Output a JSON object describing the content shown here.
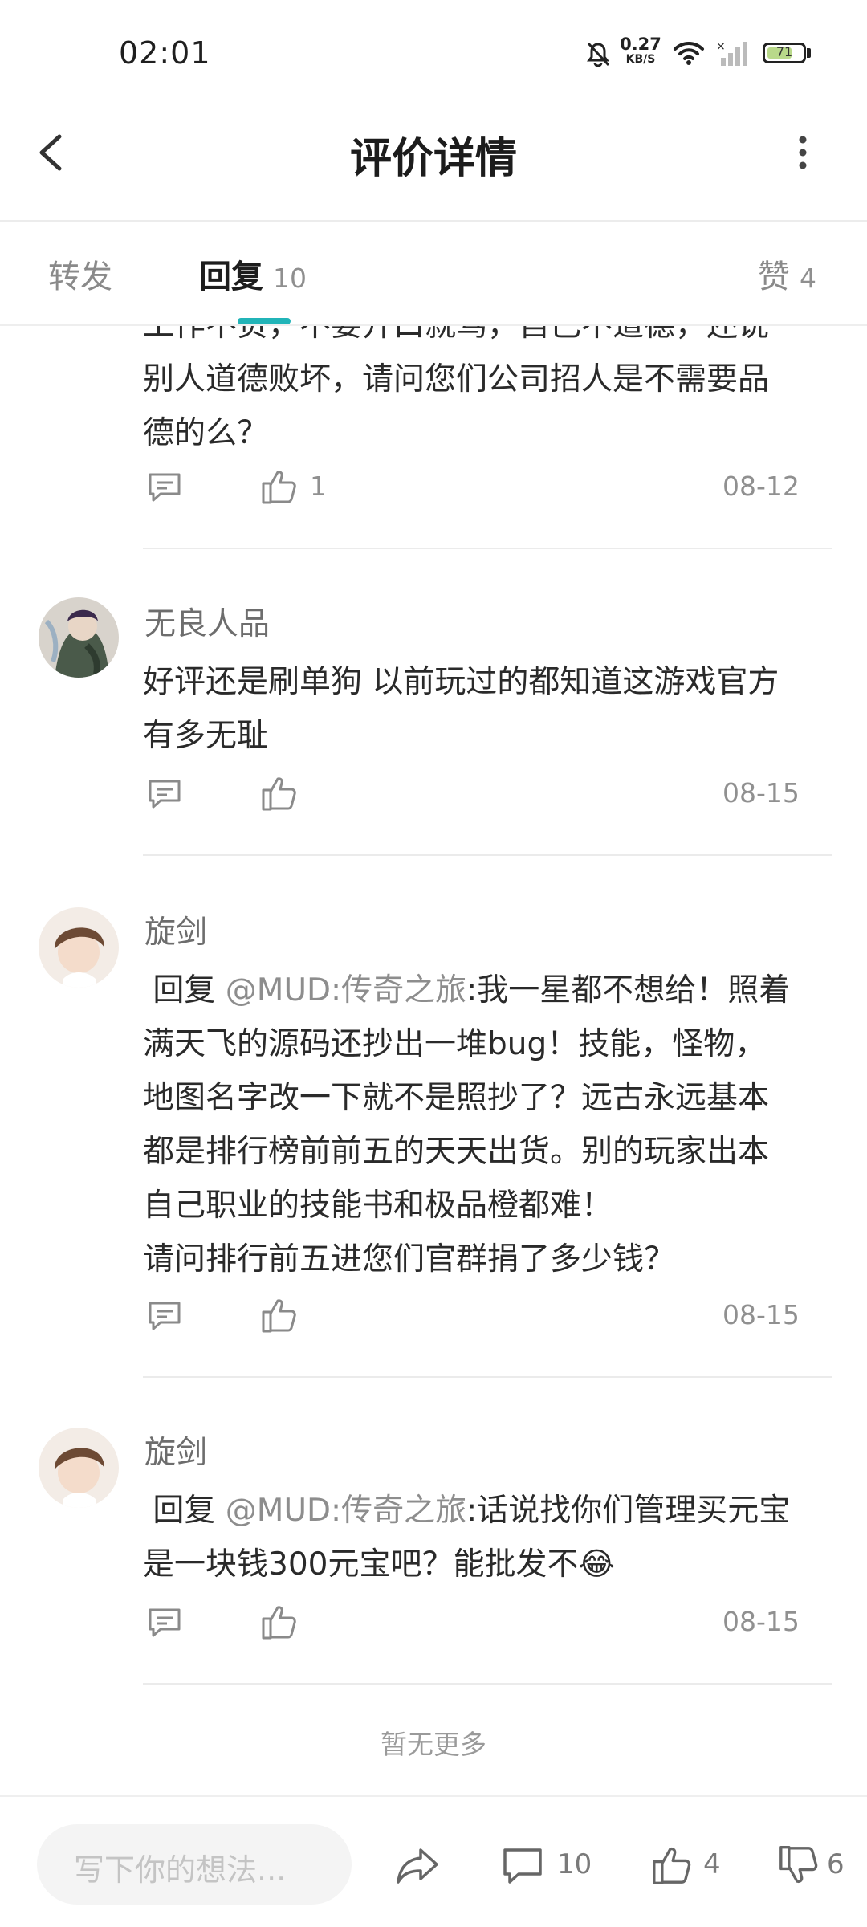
{
  "status_bar": {
    "time": "02:01",
    "net_speed": "0.27",
    "net_unit": "KB/S",
    "battery": "71",
    "battery_level": 0.71
  },
  "header": {
    "title": "评价详情"
  },
  "tabs": {
    "forward": "转发",
    "reply": "回复",
    "reply_count": "10",
    "likes": "赞",
    "likes_count": "4"
  },
  "comments": [
    {
      "lines": [
        "工作不负，不要开口就骂，自己不道德，还说",
        "别人道德败坏，请问您们公司招人是不需要品",
        "德的么？"
      ],
      "likes": "1",
      "date": "08-12"
    },
    {
      "username": "无良人品",
      "lines": [
        "好评还是刷单狗 以前玩过的都知道这游戏官方",
        "有多无耻"
      ],
      "likes": "",
      "date": "08-15"
    },
    {
      "username": "旋剑",
      "reply_prefix": " 回复 ",
      "mention": "@MUD:传奇之旅",
      "first_line_rest": ":我一星都不想给！照着",
      "lines": [
        "满天飞的源码还抄出一堆bug！技能，怪物，",
        "地图名字改一下就不是照抄了？远古永远基本",
        "都是排行榜前前五的天天出货。别的玩家出本",
        "自己职业的技能书和极品橙都难！",
        "请问排行前五进您们官群捐了多少钱？"
      ],
      "likes": "",
      "date": "08-15"
    },
    {
      "username": "旋剑",
      "reply_prefix": " 回复 ",
      "mention": "@MUD:传奇之旅",
      "first_line_rest": ":话说找你们管理买元宝",
      "lines": [
        "是一块钱300元宝吧？能批发不😂"
      ],
      "likes": "",
      "date": "08-15"
    }
  ],
  "footer_note": "暂无更多",
  "bottom_bar": {
    "input_placeholder": "写下你的想法...",
    "comment_count": "10",
    "like_count": "4",
    "dislike_count": "6"
  },
  "colors": {
    "accent": "#21b4b8",
    "mention": "#8d8d8d",
    "text": "#2a2a2a"
  },
  "icons": [
    "bell-muted-icon",
    "wifi-icon",
    "signal-icon",
    "battery-icon",
    "back-arrow-icon",
    "more-vertical-icon",
    "comment-icon",
    "thumbs-up-icon",
    "share-icon",
    "thumbs-down-icon"
  ]
}
